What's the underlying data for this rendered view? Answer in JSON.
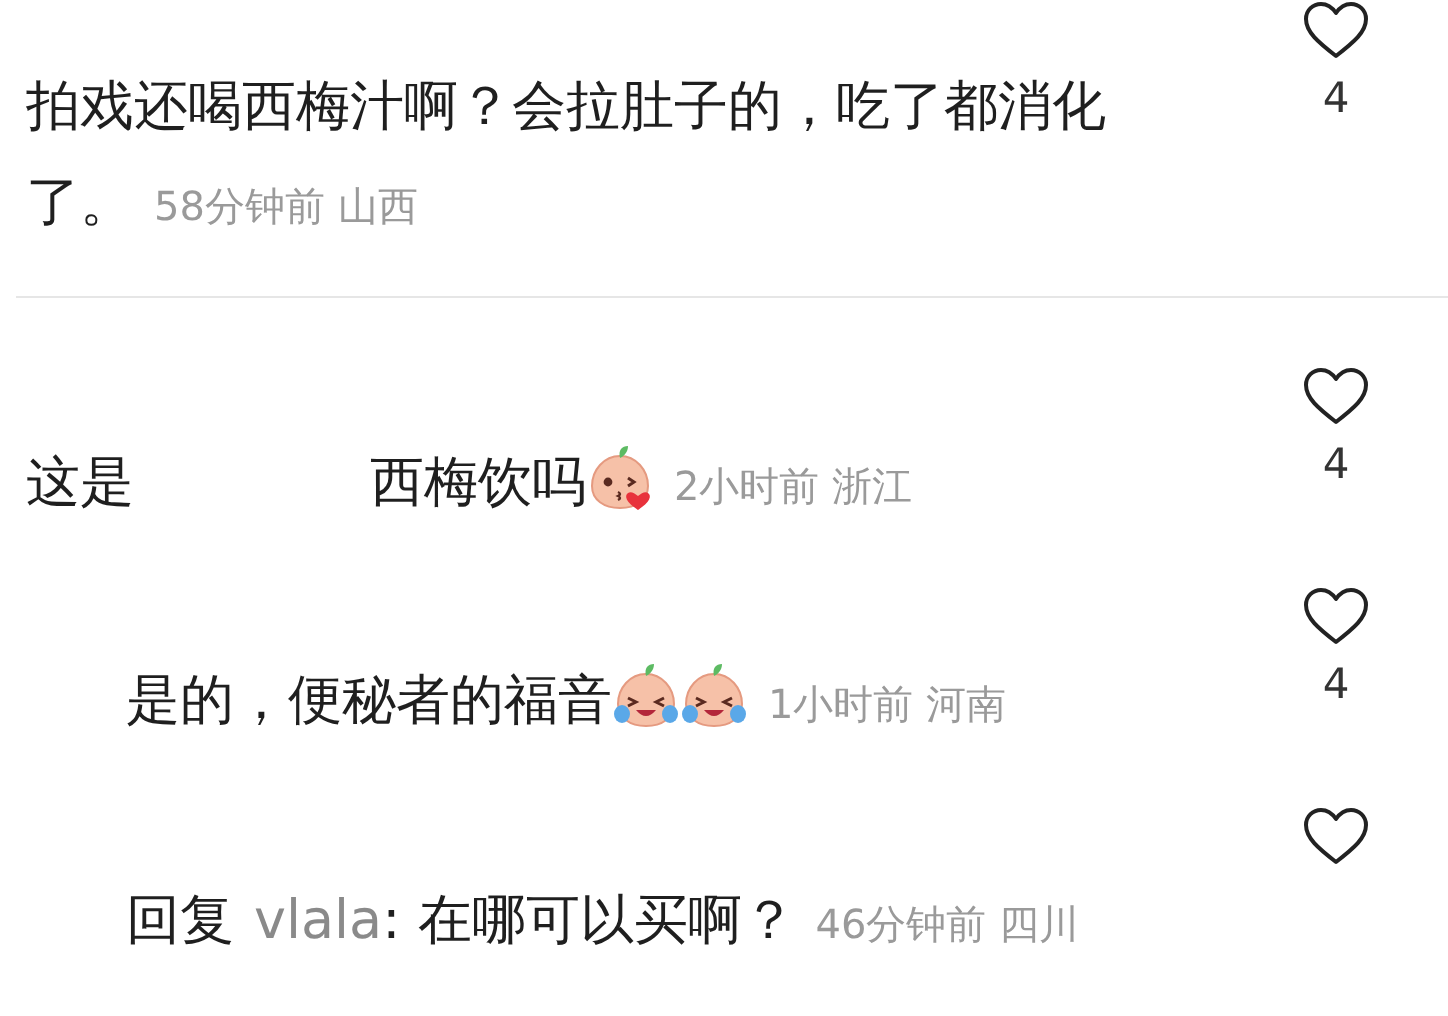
{
  "comments": [
    {
      "segments": [
        {
          "kind": "text",
          "text": "拍戏还喝西梅汁啊？会拉肚子的，吃了都消化"
        },
        {
          "kind": "text",
          "text": "了。"
        }
      ],
      "time": "58分钟前",
      "region": "山西",
      "likes": "4"
    },
    {
      "segments": [
        {
          "kind": "text",
          "text": "这是"
        },
        {
          "kind": "hidden"
        },
        {
          "kind": "text",
          "text": "西梅饮吗"
        }
      ],
      "emojis": [
        {
          "kind": "kiss"
        }
      ],
      "time": "2小时前",
      "region": "浙江",
      "likes": "4",
      "replies": [
        {
          "segments": [
            {
              "kind": "text",
              "text": "是的，便秘者的福音"
            }
          ],
          "emojis": [
            {
              "kind": "cry"
            },
            {
              "kind": "cry"
            }
          ],
          "time": "1小时前",
          "region": "河南",
          "likes": "4"
        },
        {
          "segments": [
            {
              "kind": "text",
              "text": "回复"
            },
            {
              "kind": "mention",
              "text": "vlala"
            },
            {
              "kind": "text",
              "text": ": 在哪可以买啊？"
            }
          ],
          "time": "46分钟前",
          "region": "四川"
        }
      ]
    }
  ]
}
